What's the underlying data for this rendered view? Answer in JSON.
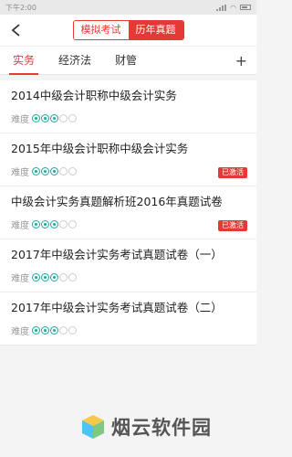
{
  "status": {
    "time": "下午2:00"
  },
  "nav": {
    "segments": [
      {
        "label": "模拟考试",
        "active": false
      },
      {
        "label": "历年真题",
        "active": true
      }
    ]
  },
  "tabs": [
    {
      "label": "实务",
      "active": true
    },
    {
      "label": "经济法",
      "active": false
    },
    {
      "label": "财管",
      "active": false
    }
  ],
  "add_tab": "+",
  "difficulty_label": "难度",
  "items": [
    {
      "title": "2014中级会计职称中级会计实务",
      "difficulty": 3,
      "badge": ""
    },
    {
      "title": "2015年中级会计职称中级会计实务",
      "difficulty": 3,
      "badge": "已激活"
    },
    {
      "title": "中级会计实务真题解析班2016年真题试卷",
      "difficulty": 3,
      "badge": "已激活"
    },
    {
      "title": "2017年中级会计实务考试真题试卷（一）",
      "difficulty": 3,
      "badge": ""
    },
    {
      "title": "2017年中级会计实务考试真题试卷（二）",
      "difficulty": 3,
      "badge": ""
    }
  ],
  "watermark": "烟云软件园",
  "colors": {
    "accent": "#e53935",
    "difficulty": "#1aab9a"
  }
}
